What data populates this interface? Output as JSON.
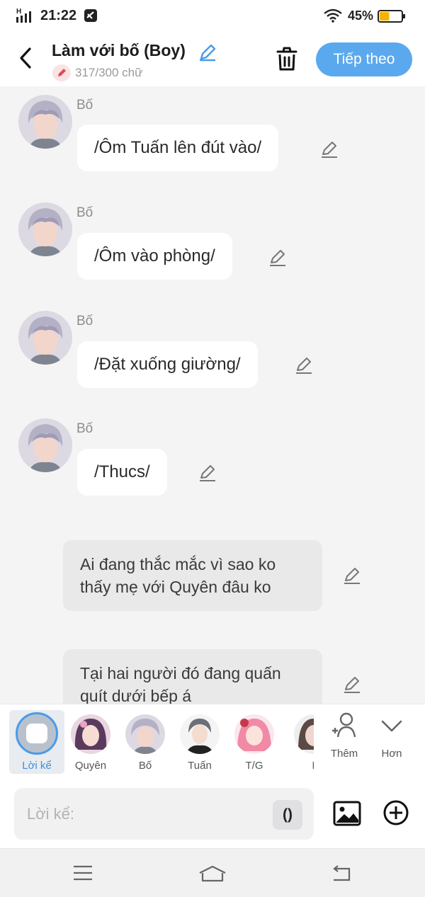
{
  "status_bar": {
    "network": "H",
    "time": "21:22",
    "battery_percent": "45%",
    "battery_level": 0.45
  },
  "header": {
    "title": "Làm với bố (Boy)",
    "word_count": "317/300 chữ",
    "next_label": "Tiếp theo"
  },
  "messages": [
    {
      "sender": "Bố",
      "text": "/Ôm Tuấn lên đút vào/"
    },
    {
      "sender": "Bố",
      "text": "/Ôm vào phòng/"
    },
    {
      "sender": "Bố",
      "text": "/Đặt xuống giường/"
    },
    {
      "sender": "Bố",
      "text": "/Thucs/"
    }
  ],
  "narrations": [
    {
      "text": "Ai đang thắc mắc vì sao ko thấy mẹ với Quyên đâu ko"
    },
    {
      "text": "Tại hai người đó đang quấn quít dưới bếp á"
    }
  ],
  "tabs": [
    {
      "label": "Lời kể",
      "active": true
    },
    {
      "label": "Quyên"
    },
    {
      "label": "Bố"
    },
    {
      "label": "Tuấn"
    },
    {
      "label": "T/G"
    },
    {
      "label": "M"
    },
    {
      "label": "Thêm"
    },
    {
      "label": "Hơn"
    }
  ],
  "input": {
    "placeholder": "Lời kể:",
    "paren_label": "()"
  },
  "colors": {
    "accent": "#5aa9ee",
    "active_tab": "#3d8fe0",
    "counter_bg": "#fbe2e3",
    "battery": "#f4b400"
  },
  "icons": [
    "back-icon",
    "edit-icon",
    "trash-icon",
    "pencil-icon",
    "add-person-icon",
    "chevron-down-icon",
    "image-icon",
    "plus-circle-icon",
    "menu-icon",
    "home-icon",
    "back-nav-icon",
    "wifi-icon",
    "battery-icon",
    "signal-icon"
  ]
}
